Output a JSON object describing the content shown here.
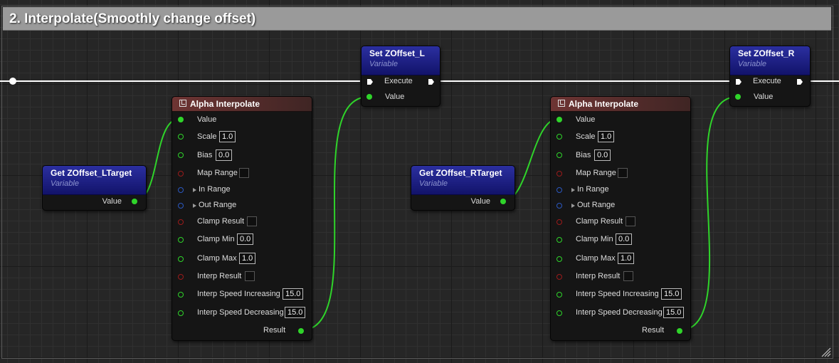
{
  "comment": {
    "title": "2. Interpolate(Smoothly change offset)"
  },
  "get_l": {
    "title": "Get ZOffset_LTarget",
    "subtitle": "Variable",
    "value_label": "Value"
  },
  "get_r": {
    "title": "Get ZOffset_RTarget",
    "subtitle": "Variable",
    "value_label": "Value"
  },
  "set_l": {
    "title": "Set ZOffset_L",
    "subtitle": "Variable",
    "execute_label": "Execute",
    "value_label": "Value"
  },
  "set_r": {
    "title": "Set ZOffset_R",
    "subtitle": "Variable",
    "execute_label": "Execute",
    "value_label": "Value"
  },
  "alpha_l": {
    "title": "Alpha Interpolate",
    "value": "Value",
    "scale": "Scale",
    "scale_val": "1.0",
    "bias": "Bias",
    "bias_val": "0.0",
    "map_range": "Map Range",
    "in_range": "In Range",
    "out_range": "Out Range",
    "clamp_result": "Clamp Result",
    "clamp_min": "Clamp Min",
    "clamp_min_val": "0.0",
    "clamp_max": "Clamp Max",
    "clamp_max_val": "1.0",
    "interp_result": "Interp Result",
    "interp_speed_inc": "Interp Speed Increasing",
    "interp_speed_inc_val": "15.0",
    "interp_speed_dec": "Interp Speed Decreasing",
    "interp_speed_dec_val": "15.0",
    "result": "Result"
  },
  "alpha_r": {
    "title": "Alpha Interpolate",
    "value": "Value",
    "scale": "Scale",
    "scale_val": "1.0",
    "bias": "Bias",
    "bias_val": "0.0",
    "map_range": "Map Range",
    "in_range": "In Range",
    "out_range": "Out Range",
    "clamp_result": "Clamp Result",
    "clamp_min": "Clamp Min",
    "clamp_min_val": "0.0",
    "clamp_max": "Clamp Max",
    "clamp_max_val": "1.0",
    "interp_result": "Interp Result",
    "interp_speed_inc": "Interp Speed Increasing",
    "interp_speed_inc_val": "15.0",
    "interp_speed_dec": "Interp Speed Decreasing",
    "interp_speed_dec_val": "15.0",
    "result": "Result"
  },
  "colors": {
    "float_pin": "#2fd42a",
    "exec_wire": "#ffffff",
    "bool_pin": "#9b1b1b",
    "struct_pin": "#2b58c0",
    "variable_header": "#1f2187",
    "function_header": "#6e3433"
  },
  "icons": {
    "function": "function-icon",
    "exec_pin": "exec-pin-icon",
    "reroute": "reroute-knot-icon",
    "resize": "resize-grip-icon"
  }
}
